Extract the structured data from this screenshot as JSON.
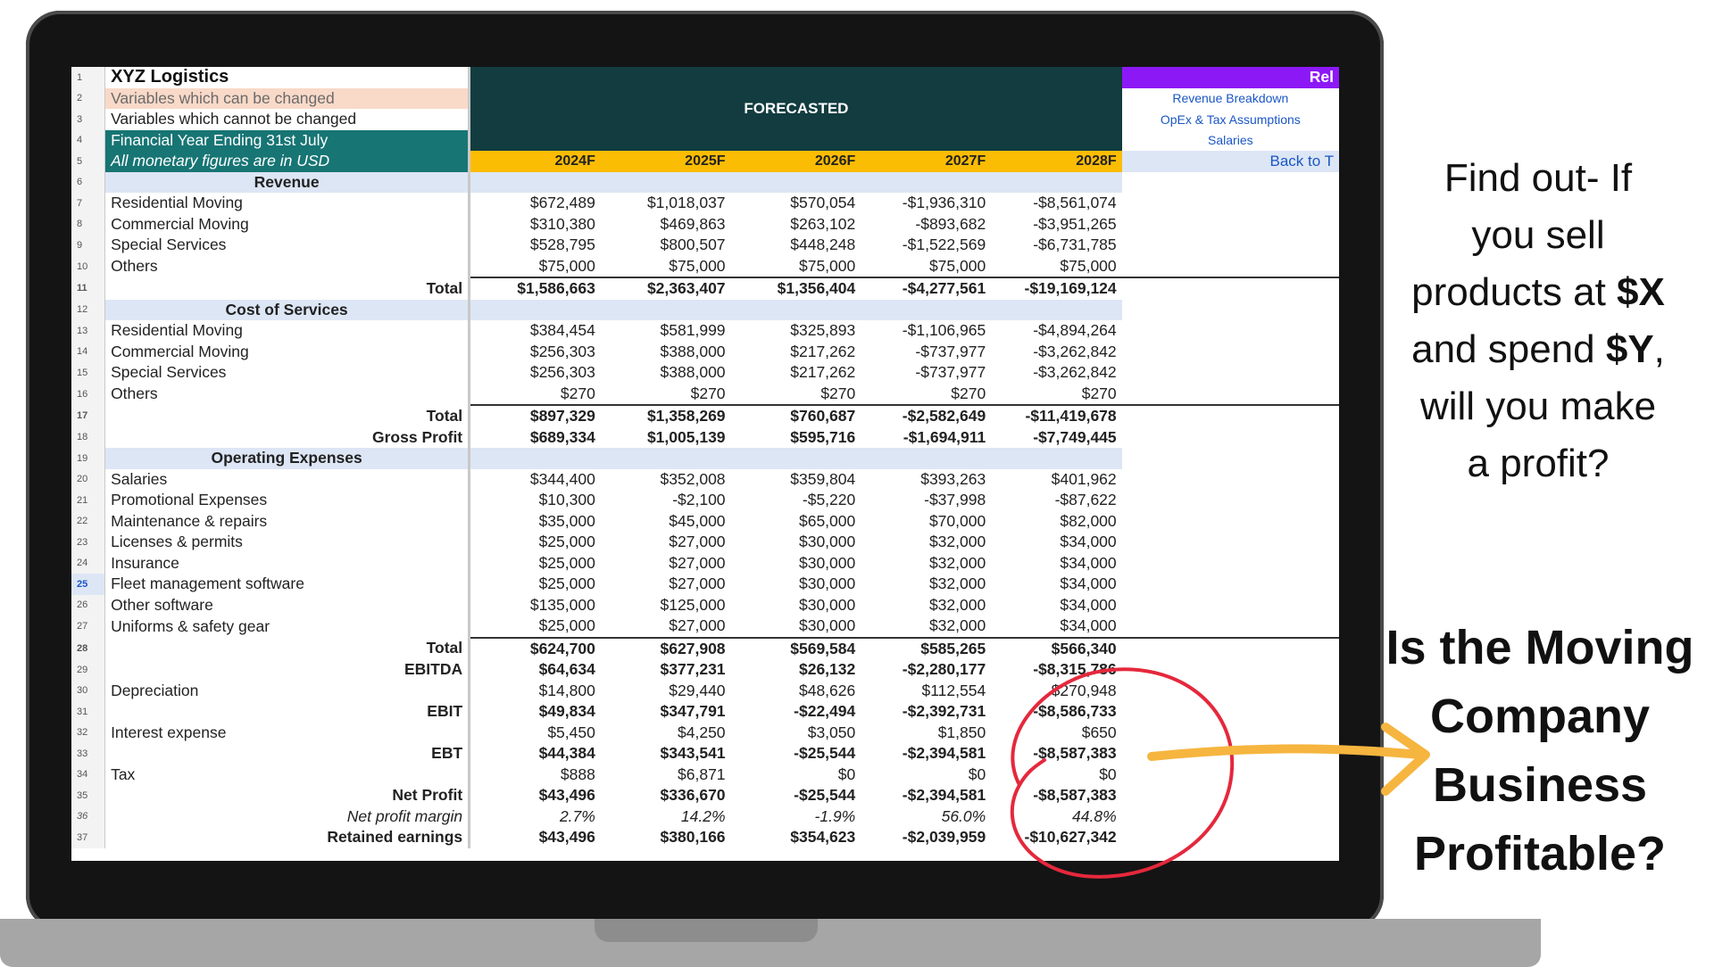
{
  "sheet": {
    "company": "XYZ Logistics",
    "legend_editable": "Variables which can be changed",
    "legend_fixed": "Variables which cannot be changed",
    "fy_label": "Financial Year Ending 31st July",
    "currency_label": "All monetary figures are in USD",
    "forecast_header": "FORECASTED",
    "years": [
      "2024F",
      "2025F",
      "2026F",
      "2027F",
      "2028F"
    ],
    "selected_row": "25",
    "rows": [
      {
        "n": "6",
        "kind": "section",
        "label": "Revenue",
        "values": []
      },
      {
        "n": "7",
        "kind": "item",
        "label": "Residential Moving",
        "values": [
          "$672,489",
          "$1,018,037",
          "$570,054",
          "-$1,936,310",
          "-$8,561,074"
        ]
      },
      {
        "n": "8",
        "kind": "item",
        "label": "Commercial Moving",
        "values": [
          "$310,380",
          "$469,863",
          "$263,102",
          "-$893,682",
          "-$3,951,265"
        ]
      },
      {
        "n": "9",
        "kind": "item",
        "label": "Special Services",
        "values": [
          "$528,795",
          "$800,507",
          "$448,248",
          "-$1,522,569",
          "-$6,731,785"
        ]
      },
      {
        "n": "10",
        "kind": "item",
        "label": "Others",
        "values": [
          "$75,000",
          "$75,000",
          "$75,000",
          "$75,000",
          "$75,000"
        ]
      },
      {
        "n": "11",
        "kind": "total",
        "label": "Total",
        "values": [
          "$1,586,663",
          "$2,363,407",
          "$1,356,404",
          "-$4,277,561",
          "-$19,169,124"
        ]
      },
      {
        "n": "12",
        "kind": "section",
        "label": "Cost of Services",
        "values": []
      },
      {
        "n": "13",
        "kind": "item",
        "label": "Residential Moving",
        "values": [
          "$384,454",
          "$581,999",
          "$325,893",
          "-$1,106,965",
          "-$4,894,264"
        ]
      },
      {
        "n": "14",
        "kind": "item",
        "label": "Commercial Moving",
        "values": [
          "$256,303",
          "$388,000",
          "$217,262",
          "-$737,977",
          "-$3,262,842"
        ]
      },
      {
        "n": "15",
        "kind": "item",
        "label": "Special Services",
        "values": [
          "$256,303",
          "$388,000",
          "$217,262",
          "-$737,977",
          "-$3,262,842"
        ]
      },
      {
        "n": "16",
        "kind": "item",
        "label": "Others",
        "values": [
          "$270",
          "$270",
          "$270",
          "$270",
          "$270"
        ]
      },
      {
        "n": "17",
        "kind": "total",
        "label": "Total",
        "values": [
          "$897,329",
          "$1,358,269",
          "$760,687",
          "-$2,582,649",
          "-$11,419,678"
        ]
      },
      {
        "n": "18",
        "kind": "bold",
        "label": "Gross Profit",
        "values": [
          "$689,334",
          "$1,005,139",
          "$595,716",
          "-$1,694,911",
          "-$7,749,445"
        ]
      },
      {
        "n": "19",
        "kind": "section",
        "label": "Operating Expenses",
        "values": []
      },
      {
        "n": "20",
        "kind": "item",
        "label": "Salaries",
        "values": [
          "$344,400",
          "$352,008",
          "$359,804",
          "$393,263",
          "$401,962"
        ]
      },
      {
        "n": "21",
        "kind": "item",
        "label": "Promotional Expenses",
        "values": [
          "$10,300",
          "-$2,100",
          "-$5,220",
          "-$37,998",
          "-$87,622"
        ]
      },
      {
        "n": "22",
        "kind": "item",
        "label": "Maintenance & repairs",
        "values": [
          "$35,000",
          "$45,000",
          "$65,000",
          "$70,000",
          "$82,000"
        ]
      },
      {
        "n": "23",
        "kind": "item",
        "label": "Licenses & permits",
        "values": [
          "$25,000",
          "$27,000",
          "$30,000",
          "$32,000",
          "$34,000"
        ]
      },
      {
        "n": "24",
        "kind": "item",
        "label": "Insurance",
        "values": [
          "$25,000",
          "$27,000",
          "$30,000",
          "$32,000",
          "$34,000"
        ]
      },
      {
        "n": "25",
        "kind": "item",
        "label": "Fleet management software",
        "values": [
          "$25,000",
          "$27,000",
          "$30,000",
          "$32,000",
          "$34,000"
        ]
      },
      {
        "n": "26",
        "kind": "item",
        "label": "Other software",
        "values": [
          "$135,000",
          "$125,000",
          "$30,000",
          "$32,000",
          "$34,000"
        ]
      },
      {
        "n": "27",
        "kind": "item",
        "label": "Uniforms & safety gear",
        "values": [
          "$25,000",
          "$27,000",
          "$30,000",
          "$32,000",
          "$34,000"
        ]
      },
      {
        "n": "28",
        "kind": "total",
        "label": "Total",
        "values": [
          "$624,700",
          "$627,908",
          "$569,584",
          "$585,265",
          "$566,340"
        ]
      },
      {
        "n": "29",
        "kind": "bold",
        "label": "EBITDA",
        "values": [
          "$64,634",
          "$377,231",
          "$26,132",
          "-$2,280,177",
          "-$8,315,786"
        ]
      },
      {
        "n": "30",
        "kind": "item",
        "label": "Depreciation",
        "values": [
          "$14,800",
          "$29,440",
          "$48,626",
          "$112,554",
          "$270,948"
        ]
      },
      {
        "n": "31",
        "kind": "bold",
        "label": "EBIT",
        "values": [
          "$49,834",
          "$347,791",
          "-$22,494",
          "-$2,392,731",
          "-$8,586,733"
        ]
      },
      {
        "n": "32",
        "kind": "item",
        "label": "Interest expense",
        "values": [
          "$5,450",
          "$4,250",
          "$3,050",
          "$1,850",
          "$650"
        ]
      },
      {
        "n": "33",
        "kind": "bold",
        "label": "EBT",
        "values": [
          "$44,384",
          "$343,541",
          "-$25,544",
          "-$2,394,581",
          "-$8,587,383"
        ]
      },
      {
        "n": "34",
        "kind": "item",
        "label": "Tax",
        "values": [
          "$888",
          "$6,871",
          "$0",
          "$0",
          "$0"
        ]
      },
      {
        "n": "35",
        "kind": "bold",
        "label": "Net Profit",
        "values": [
          "$43,496",
          "$336,670",
          "-$25,544",
          "-$2,394,581",
          "-$8,587,383"
        ]
      },
      {
        "n": "36",
        "kind": "italic",
        "label": "Net profit margin",
        "values": [
          "2.7%",
          "14.2%",
          "-1.9%",
          "56.0%",
          "44.8%"
        ]
      },
      {
        "n": "37",
        "kind": "bold",
        "label": "Retained earnings",
        "values": [
          "$43,496",
          "$380,166",
          "$354,623",
          "-$2,039,959",
          "-$10,627,342"
        ]
      }
    ]
  },
  "side_panel": {
    "header": "Rel",
    "links": [
      "Revenue Breakdown",
      "OpEx & Tax Assumptions",
      "Salaries"
    ],
    "back": "Back to T"
  },
  "question": {
    "line1": "Find out- If",
    "line2": "you sell",
    "line3_pre": "products at ",
    "line3_bold": "$X",
    "line4_pre": "and spend ",
    "line4_bold": "$Y",
    "line4_post": ",",
    "line5": "will you make",
    "line6": "a profit?"
  },
  "headline": {
    "line1": "Is the Moving",
    "line2": "Company",
    "line3": "Business",
    "line4": "Profitable?"
  },
  "colors": {
    "annotation_circle": "#e5283c",
    "annotation_arrow": "#f6b53f",
    "forecast_header_bg": "#123c3f",
    "year_row_bg": "#fbbc04",
    "side_header_bg": "#8d18f6"
  }
}
